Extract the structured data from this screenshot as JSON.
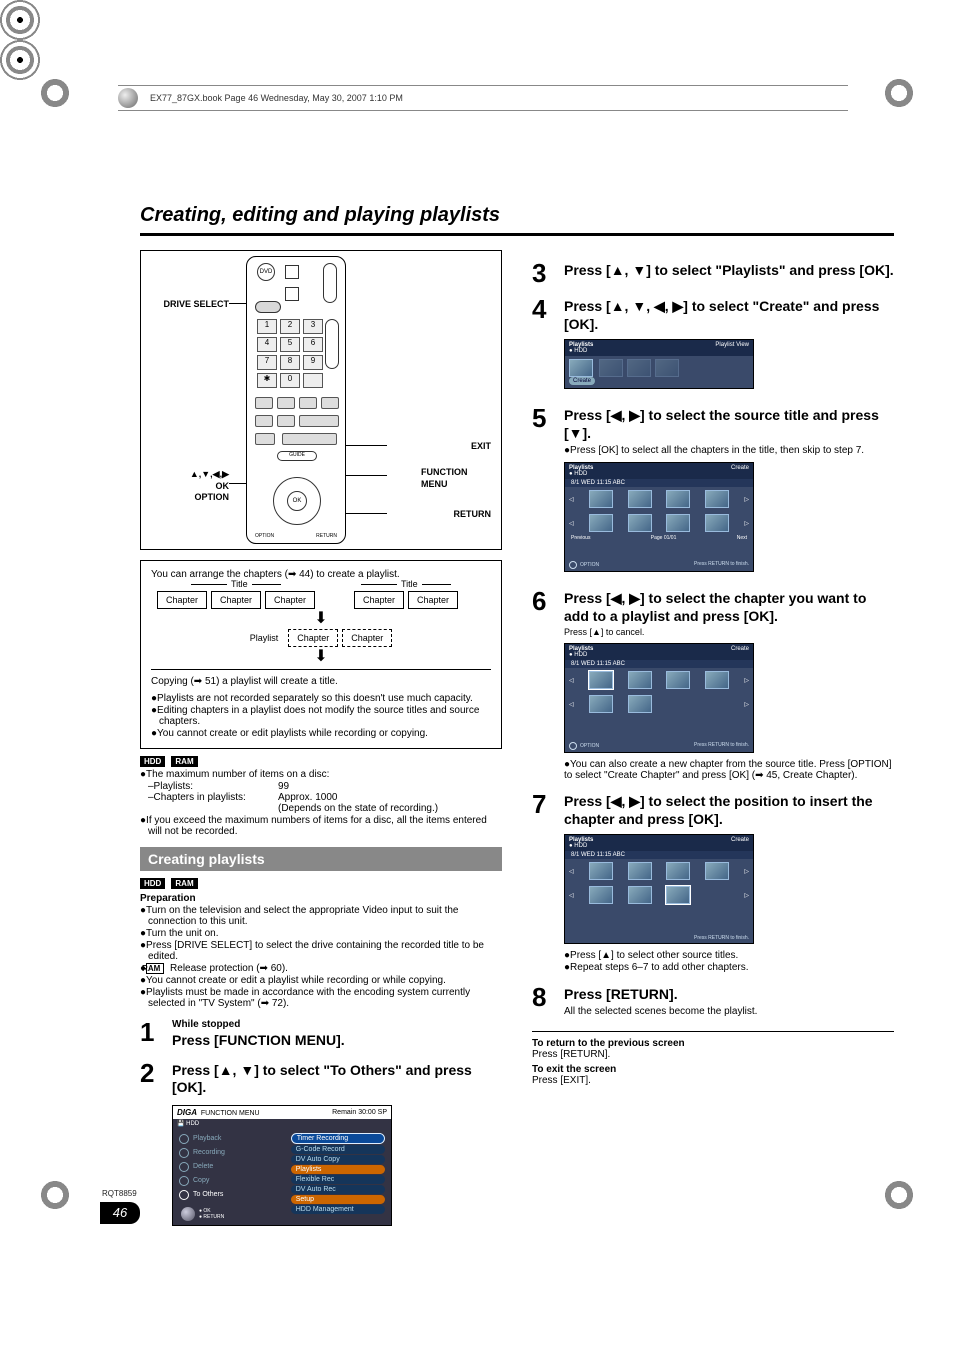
{
  "book_header": "EX77_87GX.book   Page 46   Wednesday, May 30, 2007   1:10 PM",
  "title": "Creating, editing and playing playlists",
  "remote": {
    "drive_select": "DRIVE SELECT",
    "arrows_ok_option": "▲,▼,◀,▶\nOK\nOPTION",
    "exit": "EXIT",
    "function_menu": "FUNCTION MENU",
    "return": "RETURN",
    "keys": [
      "1",
      "2",
      "3",
      "4",
      "5",
      "6",
      "7",
      "8",
      "9",
      "0"
    ],
    "ok": "OK"
  },
  "playlist_diagram": {
    "intro": "You can arrange the chapters (➡ 44) to create a playlist.",
    "title_label": "Title",
    "chapter": "Chapter",
    "playlist": "Playlist",
    "copying": "Copying (➡ 51) a playlist will create a title.",
    "notes": [
      "Playlists are not recorded separately so this doesn't use much capacity.",
      "Editing chapters in a playlist does not modify the source titles and source chapters.",
      "You cannot create or edit playlists while recording or copying."
    ]
  },
  "tags": {
    "hdd": "HDD",
    "ram": "RAM"
  },
  "disc_limits": {
    "intro": "The maximum number of items on a disc:",
    "playlists_label": "–Playlists:",
    "playlists_value": "99",
    "chapters_label": "–Chapters in playlists:",
    "chapters_value": "Approx. 1000",
    "depends": "(Depends on the state of recording.)",
    "exceed": "If you exceed the maximum numbers of items for a disc, all the items entered will not be recorded."
  },
  "section_bar": "Creating playlists",
  "preparation": {
    "heading": "Preparation",
    "items": [
      "Turn on the television and select the appropriate Video input to suit the connection to this unit.",
      "Turn the unit on.",
      "Press [DRIVE SELECT] to select the drive containing the recorded title to be edited.",
      "RAM_TAG Release protection (➡ 60).",
      "You cannot create or edit a playlist while recording or while copying.",
      "Playlists must be made in accordance with the encoding system currently selected in \"TV System\" (➡ 72)."
    ]
  },
  "steps": [
    {
      "n": "1",
      "lead": "While stopped",
      "title": "Press [FUNCTION MENU]."
    },
    {
      "n": "2",
      "title": "Press [▲, ▼] to select \"To Others\" and press [OK]."
    },
    {
      "n": "3",
      "title": "Press [▲, ▼] to select \"Playlists\" and press [OK]."
    },
    {
      "n": "4",
      "title": "Press [▲, ▼, ◀, ▶] to select \"Create\" and press [OK]."
    },
    {
      "n": "5",
      "title": "Press [◀, ▶] to select the source title and press [▼].",
      "note": "●Press [OK] to select all the chapters in the title, then skip to step 7."
    },
    {
      "n": "6",
      "title": "Press [◀, ▶] to select the chapter you want to add to a playlist and press [OK].",
      "sub": "Press [▲] to cancel.",
      "post": "●You can also create a new chapter from the source title. Press [OPTION] to select \"Create Chapter\" and press [OK] (➡ 45, Create Chapter)."
    },
    {
      "n": "7",
      "title": "Press [◀, ▶] to select the position to insert the chapter and press [OK].",
      "after": [
        "●Press [▲] to select other source titles.",
        "●Repeat steps 6–7 to add other chapters."
      ]
    },
    {
      "n": "8",
      "title": "Press [RETURN].",
      "sub2": "All the selected scenes become the playlist."
    }
  ],
  "footer": {
    "return_hd": "To return to the previous screen",
    "return_tx": "Press [RETURN].",
    "exit_hd": "To exit the screen",
    "exit_tx": "Press [EXIT]."
  },
  "function_menu": {
    "head": "FUNCTION MENU",
    "remain": "Remain  30:00 SP",
    "hdd": "HDD",
    "left": [
      "Playback",
      "Recording",
      "Delete",
      "Copy",
      "To Others"
    ],
    "right": [
      "Timer Recording",
      "G-Code Record",
      "DV Auto Copy",
      "Playlists",
      "Flexible Rec",
      "DV Auto Rec",
      "Setup",
      "HDD Management"
    ],
    "ok": "OK",
    "return": "RETURN"
  },
  "mini": {
    "playlists": "Playlists",
    "hdd": "● HDD",
    "playlist_view": "Playlist View",
    "create": "Create",
    "date": "8/1 WED  11:15  ABC",
    "option": "OPTION",
    "press_return": "Press RETURN to finish.",
    "prev": "Previous",
    "next": "Next",
    "page": "Page 01/01"
  },
  "page_number": "46",
  "rqt": "RQT8859"
}
